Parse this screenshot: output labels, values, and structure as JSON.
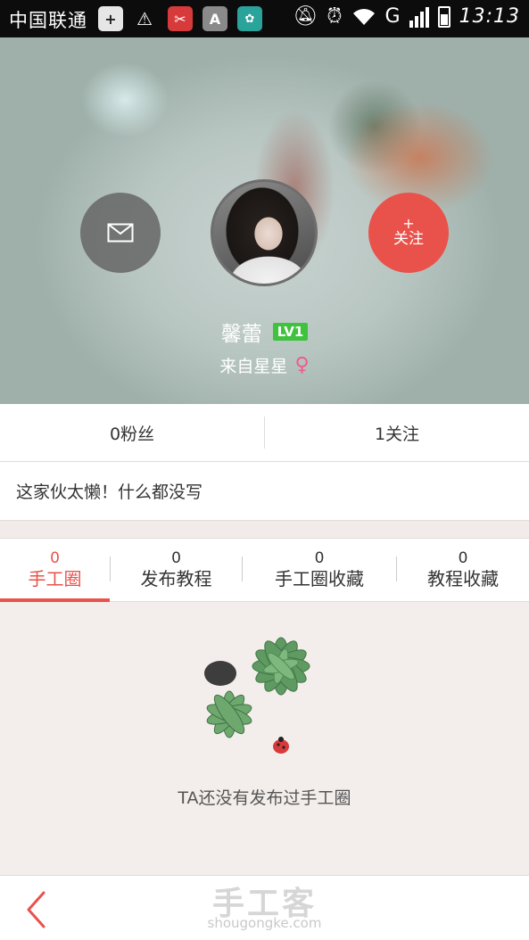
{
  "status_bar": {
    "carrier": "中国联通",
    "time": "13:13",
    "network": "G",
    "notification_icons": [
      "plus-icon",
      "battery-alert-icon",
      "scissors-app-icon",
      "a-app-icon",
      "huawei-app-icon"
    ],
    "status_icons": [
      "mute-icon",
      "alarm-icon",
      "wifi-icon",
      "signal-icon",
      "battery-icon"
    ]
  },
  "profile": {
    "name": "馨蕾",
    "level": "LV1",
    "location": "来自星星",
    "gender_symbol": "♀",
    "follow_plus": "+",
    "follow_label": "关注",
    "colors": {
      "accent": "#e9524a",
      "level_badge": "#3fc23d",
      "gender": "#f05a8c"
    }
  },
  "stats": {
    "fans": "0粉丝",
    "following": "1关注"
  },
  "bio": "这家伙太懒！什么都没写",
  "tabs": [
    {
      "count": "0",
      "label": "手工圈",
      "active": true
    },
    {
      "count": "0",
      "label": "发布教程",
      "active": false
    },
    {
      "count": "0",
      "label": "手工圈收藏",
      "active": false
    },
    {
      "count": "0",
      "label": "教程收藏",
      "active": false
    }
  ],
  "empty_state": {
    "message": "TA还没有发布过手工圈"
  },
  "watermark": {
    "brand": "手工客",
    "url": "shougongke.com"
  }
}
